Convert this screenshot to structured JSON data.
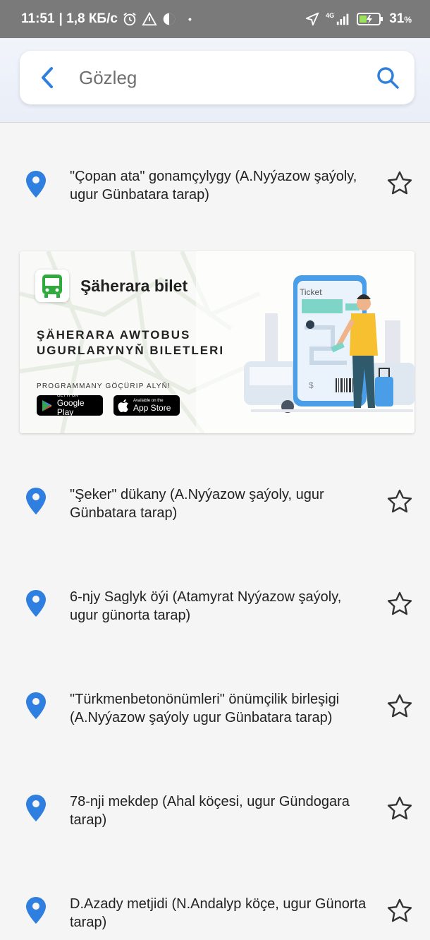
{
  "status_bar": {
    "time": "11:51",
    "speed": "| 1,8 КБ/с",
    "network": "4G",
    "battery": "31",
    "battery_unit": "%"
  },
  "search": {
    "placeholder": "Gözleg"
  },
  "stops": [
    {
      "name": "\"Çopan ata\" gonamçylygy (A.Nyýazow şaýoly, ugur Günbatara tarap)"
    },
    {
      "name": "\"Şeker\" dükany (A.Nyýazow şaýoly, ugur Günbatara tarap)"
    },
    {
      "name": "6-njy Saglyk öýi (Atamyrat Nyýazow şaýoly, ugur günorta tarap)"
    },
    {
      "name": "\"Türkmenbetonönümleri\" önümçilik birleşigi (A.Nyýazow şaýoly ugur  Günbatara tarap)"
    },
    {
      "name": "78-nji mekdep  (Ahal köçesi, ugur Gündogara tarap)"
    },
    {
      "name": "D.Azady metjidi (N.Andalyp köçe, ugur Günorta tarap)"
    }
  ],
  "banner": {
    "title": "Şäherara bilet",
    "headline_1": "ŞÄHERARA AWTOBUS",
    "headline_2": "UGURLARYNYŇ BILETLERI",
    "cta": "PROGRAMMANY GÖÇÜRIP ALYŇ!",
    "google_small": "GET IT ON",
    "google_big": "Google Play",
    "apple_small": "Available on the",
    "apple_big": "App Store",
    "ticket_label": "Ticket",
    "price_symbol": "$"
  },
  "colors": {
    "accent": "#2f7fe0",
    "pin": "#2f7fe0",
    "status_bar": "#7a7a7a",
    "background": "#f5f5f5",
    "brand_green": "#2faa3c"
  }
}
